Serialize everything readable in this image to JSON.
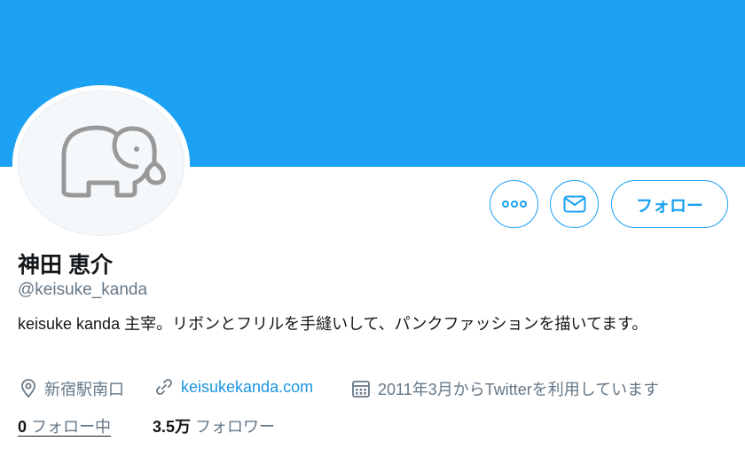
{
  "colors": {
    "accent": "#1da1f2",
    "banner": "#1da1f2",
    "link": "#1b95e0",
    "text": "#14171a",
    "muted": "#657786"
  },
  "profile": {
    "name": "神田 恵介",
    "handle": "@keisuke_kanda",
    "bio": "keisuke kanda 主宰。リボンとフリルを手縫いして、パンクファッションを描いてます。",
    "avatar_icon": "elephant-icon"
  },
  "actions": {
    "more_icon": "more-dots-icon",
    "message_icon": "envelope-icon",
    "follow_label": "フォロー"
  },
  "meta": {
    "location": "新宿駅南口",
    "location_icon": "location-pin-icon",
    "website": "keisukekanda.com",
    "website_icon": "link-icon",
    "joined": "2011年3月からTwitterを利用しています",
    "joined_icon": "calendar-icon"
  },
  "stats": {
    "following_count": "0",
    "following_label": "フォロー中",
    "followers_count": "3.5万",
    "followers_label": "フォロワー"
  }
}
